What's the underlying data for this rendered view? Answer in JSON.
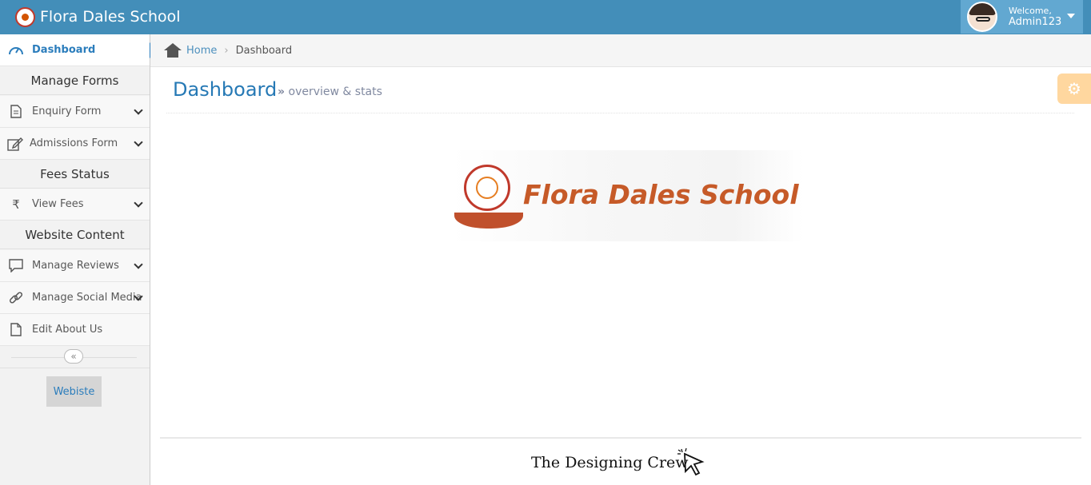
{
  "header": {
    "brand": "Flora Dales School",
    "welcome_label": "Welcome,",
    "username": "Admin123"
  },
  "sidebar": {
    "dashboard": "Dashboard",
    "sections": {
      "forms": "Manage Forms",
      "fees": "Fees Status",
      "website": "Website Content"
    },
    "items": {
      "enquiry": "Enquiry Form",
      "admissions": "Admissions Form",
      "fees": "View Fees",
      "reviews": "Manage Reviews",
      "social": "Manage Social Media",
      "about": "Edit About Us"
    },
    "website_button": "Webiste"
  },
  "breadcrumb": {
    "home": "Home",
    "current": "Dashboard"
  },
  "page": {
    "title": "Dashboard",
    "subtitle": "overview & stats"
  },
  "banner": {
    "school_name": "Flora Dales School"
  },
  "footer": {
    "brand": "The Designing Crew"
  },
  "colors": {
    "navbar": "#438eb9",
    "accent": "#2b7dbc",
    "banner_text": "#c65a28",
    "settings": "#ffb752"
  }
}
